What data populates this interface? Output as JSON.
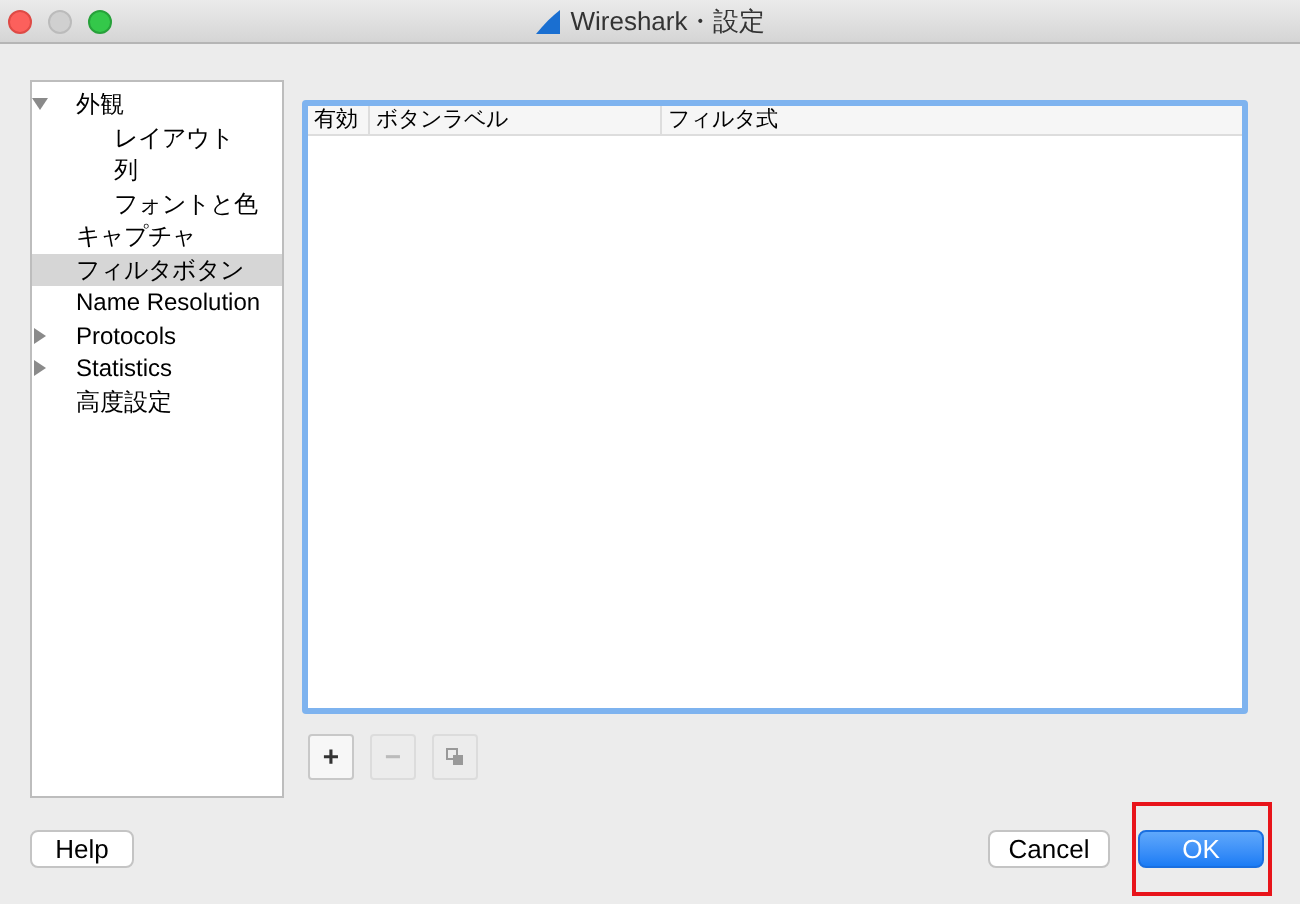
{
  "window": {
    "title": "Wireshark・設定"
  },
  "sidebar": {
    "items": [
      {
        "label": "外観",
        "selected": false,
        "expanded": true,
        "children": [
          {
            "label": "レイアウト",
            "selected": false
          },
          {
            "label": "列",
            "selected": false
          },
          {
            "label": "フォントと色",
            "selected": false
          }
        ]
      },
      {
        "label": "キャプチャ",
        "selected": false
      },
      {
        "label": "フィルタボタン",
        "selected": true
      },
      {
        "label": "Name Resolution",
        "selected": false
      },
      {
        "label": "Protocols",
        "selected": false,
        "expanded": false
      },
      {
        "label": "Statistics",
        "selected": false,
        "expanded": false
      },
      {
        "label": "高度設定",
        "selected": false
      }
    ]
  },
  "table": {
    "columns": [
      "有効",
      "ボタンラベル",
      "フィルタ式"
    ]
  },
  "table_buttons": [
    {
      "kind": "text",
      "label": "+",
      "disabled": false
    },
    {
      "kind": "text",
      "label": "−",
      "disabled": true
    },
    {
      "kind": "copy",
      "disabled": true
    }
  ],
  "buttons": [
    {
      "label": "Help",
      "default": false
    },
    {
      "label": "Cancel",
      "default": false
    },
    {
      "label": "OK",
      "default": true
    }
  ]
}
